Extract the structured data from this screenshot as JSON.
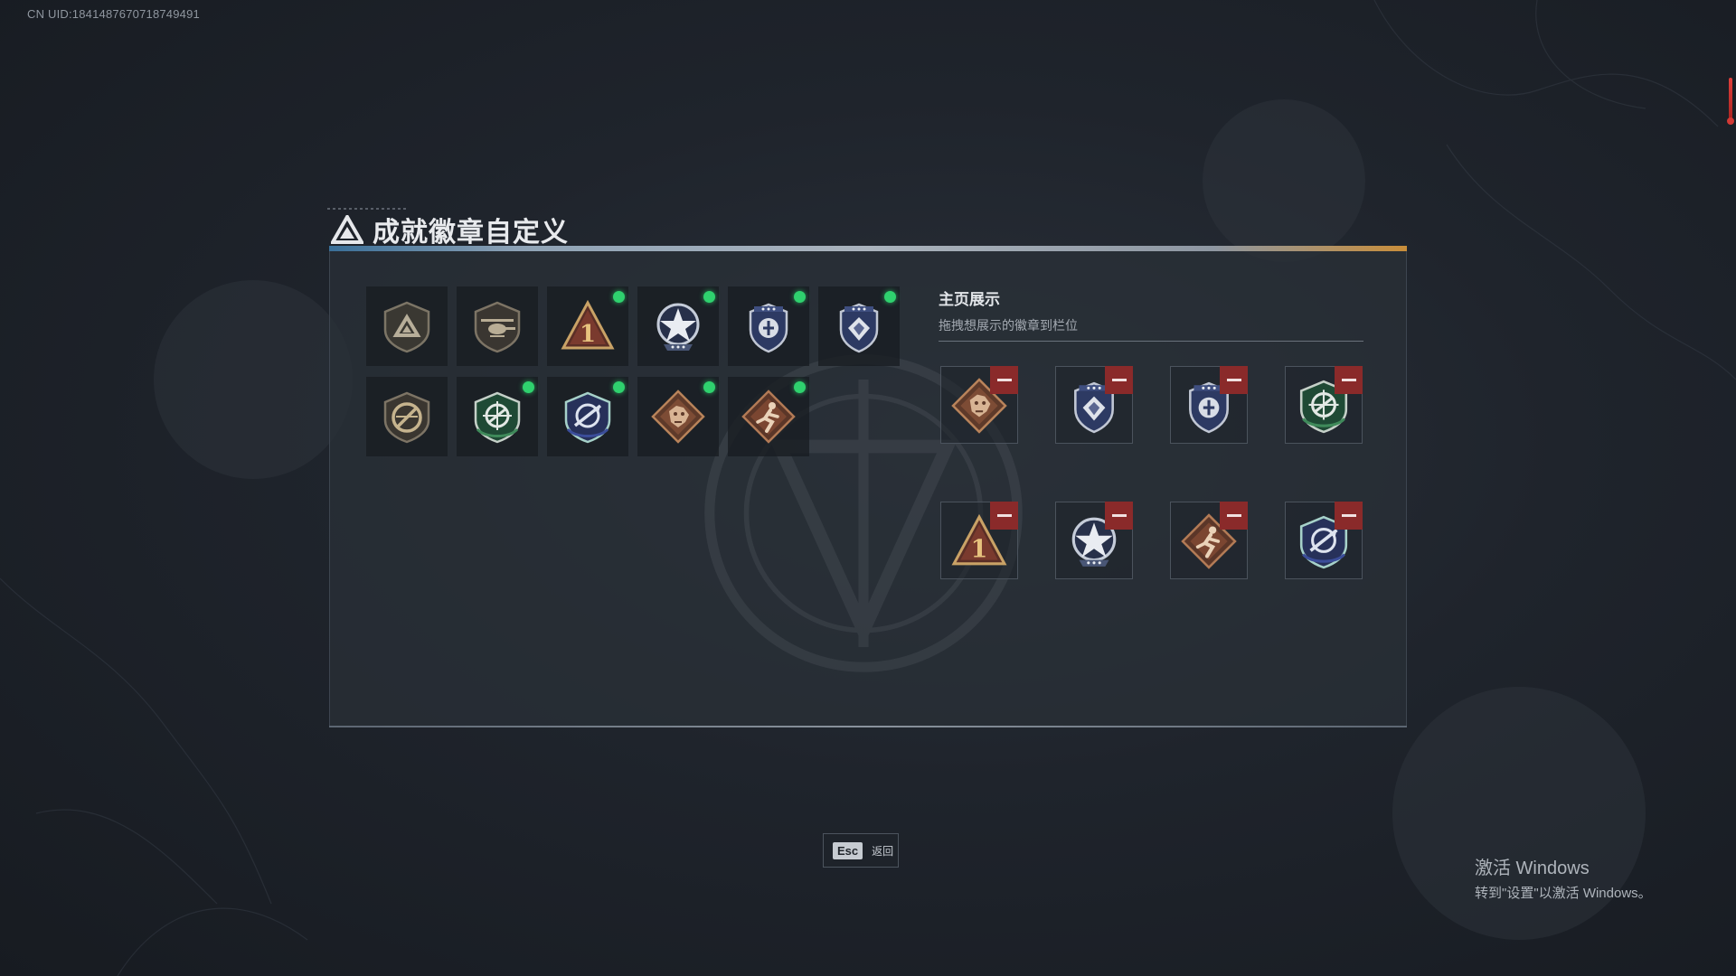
{
  "uid": "CN UID:1841487670718749491",
  "title": "成就徽章自定义",
  "badges": [
    {
      "id": "b1",
      "icon": "triangle-shield-badge-icon",
      "new": false
    },
    {
      "id": "b2",
      "icon": "helicopter-shield-badge-icon",
      "new": false
    },
    {
      "id": "b3",
      "icon": "rank-one-triangle-badge-icon",
      "new": true
    },
    {
      "id": "b4",
      "icon": "star-wing-badge-icon",
      "new": true
    },
    {
      "id": "b5",
      "icon": "blue-crest-badge-icon",
      "new": true
    },
    {
      "id": "b6",
      "icon": "blue-diamond-crest-badge-icon",
      "new": true
    },
    {
      "id": "b7",
      "icon": "no-rifle-shield-badge-icon",
      "new": false
    },
    {
      "id": "b8",
      "icon": "green-crosshair-shield-badge-icon",
      "new": true
    },
    {
      "id": "b9",
      "icon": "blue-rifle-shield-badge-icon",
      "new": true
    },
    {
      "id": "b10",
      "icon": "dragon-diamond-badge-icon",
      "new": true
    },
    {
      "id": "b11",
      "icon": "runner-diamond-badge-icon",
      "new": true
    }
  ],
  "showcase": {
    "title": "主页展示",
    "subtitle": "拖拽想展示的徽章到栏位",
    "slots": [
      {
        "icon": "dragon-diamond-badge-icon"
      },
      {
        "icon": "blue-diamond-crest-badge-icon"
      },
      {
        "icon": "blue-crest-badge-icon"
      },
      {
        "icon": "green-crosshair-shield-badge-icon"
      },
      {
        "icon": "rank-one-triangle-badge-icon"
      },
      {
        "icon": "star-wing-badge-icon"
      },
      {
        "icon": "runner-diamond-badge-icon"
      },
      {
        "icon": "blue-rifle-shield-badge-icon"
      }
    ]
  },
  "footer": {
    "esc_key": "Esc",
    "esc_label": "返回"
  },
  "activation": {
    "line1": "激活 Windows",
    "line2": "转到\"设置\"以激活 Windows。"
  },
  "colors": {
    "new_dot": "#2fd16e",
    "remove": "#8a2a2a",
    "accent_blue": "#3a6f98",
    "accent_orange": "#c98e3a"
  }
}
